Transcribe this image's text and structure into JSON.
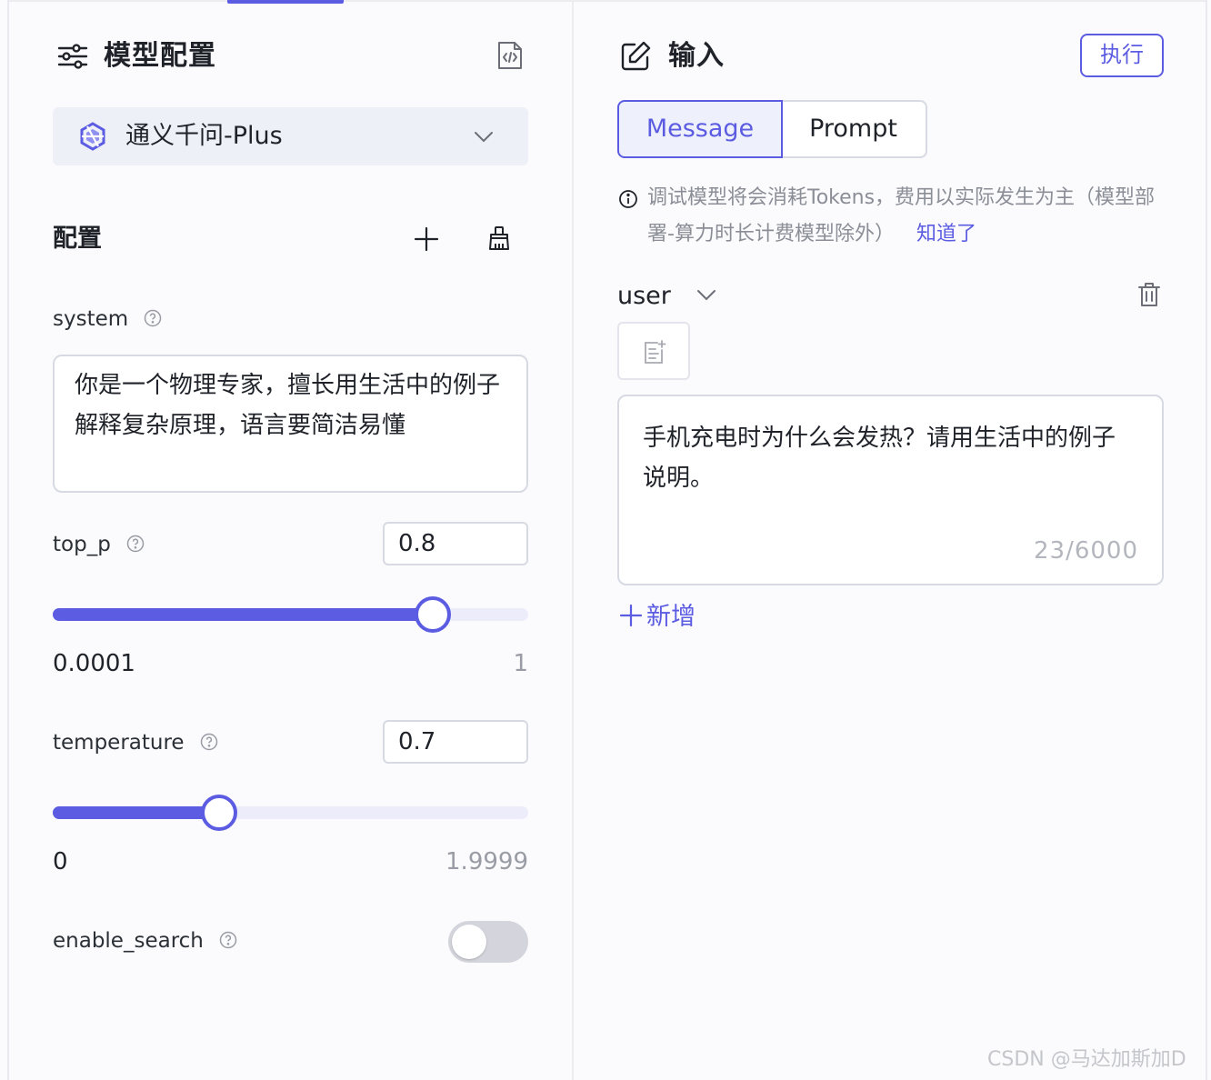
{
  "left_panel": {
    "title": "模型配置",
    "model": {
      "name": "通义千问-Plus"
    },
    "config_heading": "配置",
    "system": {
      "label": "system",
      "value": "你是一个物理专家，擅长用生活中的例子解释复杂原理，语言要简洁易懂"
    },
    "top_p": {
      "label": "top_p",
      "value": "0.8",
      "min": "0.0001",
      "max": "1",
      "fraction": 0.8
    },
    "temperature": {
      "label": "temperature",
      "value": "0.7",
      "min": "0",
      "max": "1.9999",
      "fraction": 0.35
    },
    "enable_search": {
      "label": "enable_search",
      "enabled": false
    }
  },
  "right_panel": {
    "title": "输入",
    "run_label": "执行",
    "tabs": [
      {
        "label": "Message",
        "active": true
      },
      {
        "label": "Prompt",
        "active": false
      }
    ],
    "notice": {
      "text": "调试模型将会消耗Tokens，费用以实际发生为主（模型部署-算力时长计费模型除外）",
      "link": "知道了"
    },
    "message": {
      "role": "user",
      "content": "手机充电时为什么会发热？请用生活中的例子说明。",
      "count": "23/6000"
    },
    "add_label": "新增"
  },
  "watermark": "CSDN @马达加斯加D",
  "colors": {
    "accent": "#5b5ce2",
    "border": "#d8dae3",
    "muted_text": "#8b8e97",
    "select_bg": "#eef0f8"
  },
  "icons": {
    "settings": "sliders-icon",
    "code": "code-file-icon",
    "model": "qwen-logo-icon",
    "chevron": "chevron-down-icon",
    "plus": "plus-icon",
    "clear": "broom-icon",
    "help": "question-circle-icon",
    "edit": "edit-icon",
    "info": "info-circle-icon",
    "delete": "trash-icon",
    "template": "template-file-icon"
  }
}
